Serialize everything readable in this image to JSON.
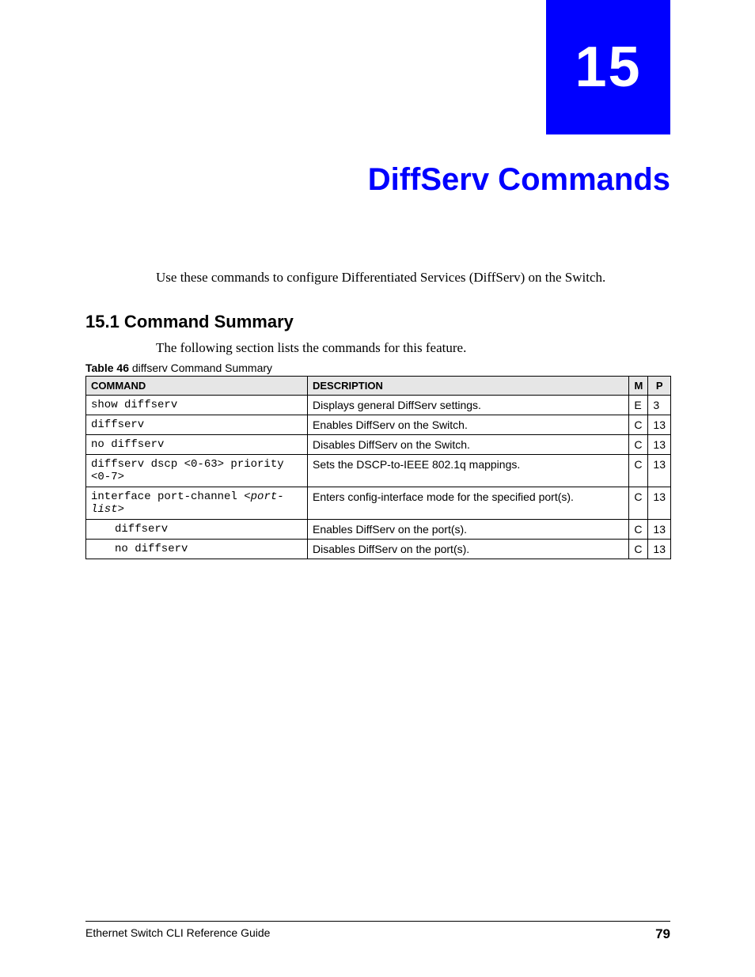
{
  "chapter": {
    "number": "15",
    "title": "DiffServ Commands"
  },
  "intro": "Use these commands to configure Differentiated Services (DiffServ) on the Switch.",
  "section": {
    "heading": "15.1  Command Summary",
    "text": "The following section lists the commands for this feature."
  },
  "table": {
    "caption_bold": "Table 46",
    "caption_text": "   diffserv Command Summary",
    "headers": {
      "command": "COMMAND",
      "description": "DESCRIPTION",
      "m": "M",
      "p": "P"
    },
    "rows": [
      {
        "cmd": "show diffserv",
        "desc": "Displays general DiffServ settings.",
        "m": "E",
        "p": "3",
        "indent": false,
        "italic": ""
      },
      {
        "cmd": "diffserv",
        "desc": "Enables DiffServ on the Switch.",
        "m": "C",
        "p": "13",
        "indent": false,
        "italic": ""
      },
      {
        "cmd": "no diffserv",
        "desc": "Disables DiffServ on the Switch.",
        "m": "C",
        "p": "13",
        "indent": false,
        "italic": ""
      },
      {
        "cmd": "diffserv dscp <0-63> priority <0-7>",
        "desc": "Sets the DSCP-to-IEEE 802.1q mappings.",
        "m": "C",
        "p": "13",
        "indent": false,
        "italic": ""
      },
      {
        "cmd_prefix": "interface port-channel <",
        "cmd_italic": "port-list",
        "cmd_suffix": ">",
        "desc": "Enters config-interface mode for the specified port(s).",
        "m": "C",
        "p": "13",
        "indent": false,
        "special": true
      },
      {
        "cmd": "diffserv",
        "desc": "Enables DiffServ on the port(s).",
        "m": "C",
        "p": "13",
        "indent": true,
        "italic": ""
      },
      {
        "cmd": "no diffserv",
        "desc": "Disables DiffServ on the port(s).",
        "m": "C",
        "p": "13",
        "indent": true,
        "italic": ""
      }
    ]
  },
  "footer": {
    "left": "Ethernet Switch CLI Reference Guide",
    "right": "79"
  }
}
